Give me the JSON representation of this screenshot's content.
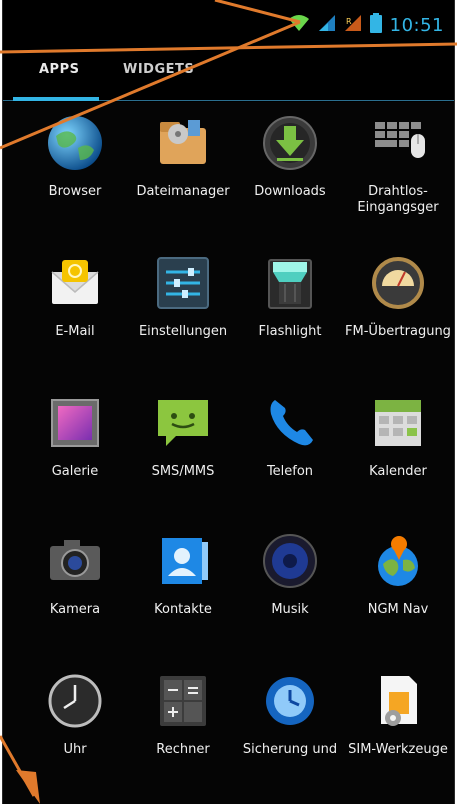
{
  "status_bar": {
    "time": "10:51",
    "icons": [
      "wifi-icon",
      "signal-icon",
      "roaming-signal-icon",
      "battery-icon"
    ]
  },
  "tabs": {
    "apps": "APPS",
    "widgets": "WIDGETS"
  },
  "apps": [
    {
      "label": "Browser",
      "icon": "browser-globe-icon"
    },
    {
      "label": "Dateimanager",
      "icon": "file-manager-icon"
    },
    {
      "label": "Downloads",
      "icon": "downloads-icon"
    },
    {
      "label": "Drahtlos-Eingangsger",
      "icon": "wireless-input-icon"
    },
    {
      "label": "E-Mail",
      "icon": "email-icon"
    },
    {
      "label": "Einstellungen",
      "icon": "settings-sliders-icon"
    },
    {
      "label": "Flashlight",
      "icon": "flashlight-icon"
    },
    {
      "label": "FM-Übertragung",
      "icon": "fm-transmitter-icon"
    },
    {
      "label": "Galerie",
      "icon": "gallery-icon"
    },
    {
      "label": "SMS/MMS",
      "icon": "messaging-icon"
    },
    {
      "label": "Telefon",
      "icon": "phone-icon"
    },
    {
      "label": "Kalender",
      "icon": "calendar-icon"
    },
    {
      "label": "Kamera",
      "icon": "camera-icon"
    },
    {
      "label": "Kontakte",
      "icon": "contacts-icon"
    },
    {
      "label": "Musik",
      "icon": "music-speaker-icon"
    },
    {
      "label": "NGM Nav",
      "icon": "navigation-globe-icon"
    },
    {
      "label": "Uhr",
      "icon": "clock-icon"
    },
    {
      "label": "Rechner",
      "icon": "calculator-icon"
    },
    {
      "label": "Sicherung und",
      "icon": "backup-icon"
    },
    {
      "label": "SIM-Werkzeuge",
      "icon": "sim-toolkit-icon"
    }
  ],
  "colors": {
    "accent": "#33b5e5",
    "annotation": "#e07a2c"
  }
}
